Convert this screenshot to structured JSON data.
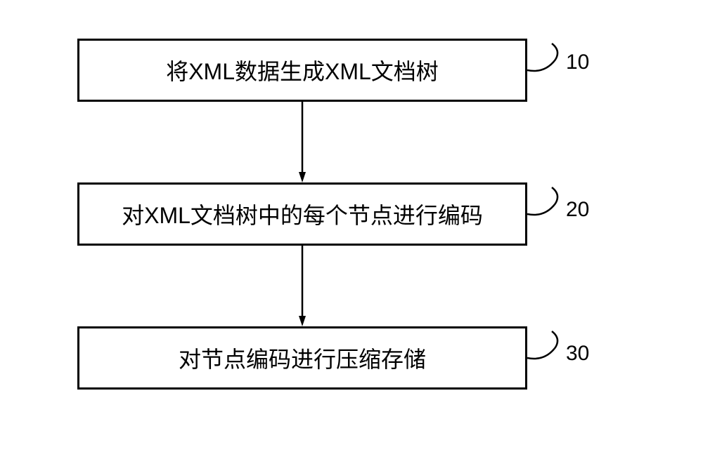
{
  "diagram": {
    "steps": [
      {
        "id": "step-1",
        "text": "将XML数据生成XML文档树",
        "label": "10"
      },
      {
        "id": "step-2",
        "text": "对XML文档树中的每个节点进行编码",
        "label": "20"
      },
      {
        "id": "step-3",
        "text": "对节点编码进行压缩存储",
        "label": "30"
      }
    ]
  }
}
